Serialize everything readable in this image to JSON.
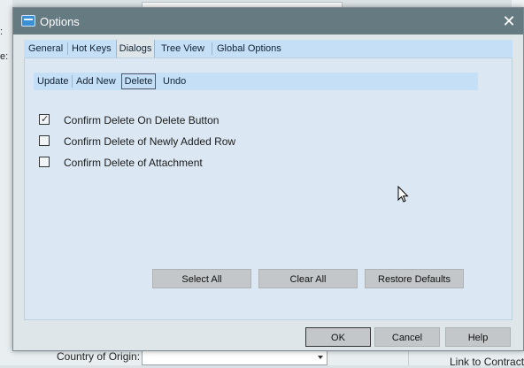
{
  "background": {
    "left_labels": [
      ":",
      "e:"
    ],
    "country_label": "Country of Origin:",
    "link_text": "Link to Contract"
  },
  "dialog": {
    "title": "Options",
    "close_glyph": "✕",
    "tabs": [
      "General",
      "Hot Keys",
      "Dialogs",
      "Tree View",
      "Global Options"
    ],
    "active_tab": "Dialogs",
    "subtabs": [
      "Update",
      "Add New",
      "Delete",
      "Undo"
    ],
    "active_subtab": "Delete",
    "options": [
      {
        "label": "Confirm Delete On Delete Button",
        "checked": true
      },
      {
        "label": "Confirm Delete of Newly Added Row",
        "checked": false
      },
      {
        "label": "Confirm Delete of Attachment",
        "checked": false
      }
    ],
    "panel_buttons": {
      "select_all": "Select All",
      "clear_all": "Clear All",
      "restore_defaults": "Restore Defaults"
    },
    "footer_buttons": {
      "ok": "OK",
      "cancel": "Cancel",
      "help": "Help"
    }
  },
  "colors": {
    "titlebar": "#667a82",
    "tabbar": "#c5dff6",
    "panel": "#dbe8f3",
    "button": "#c4c7c9"
  }
}
